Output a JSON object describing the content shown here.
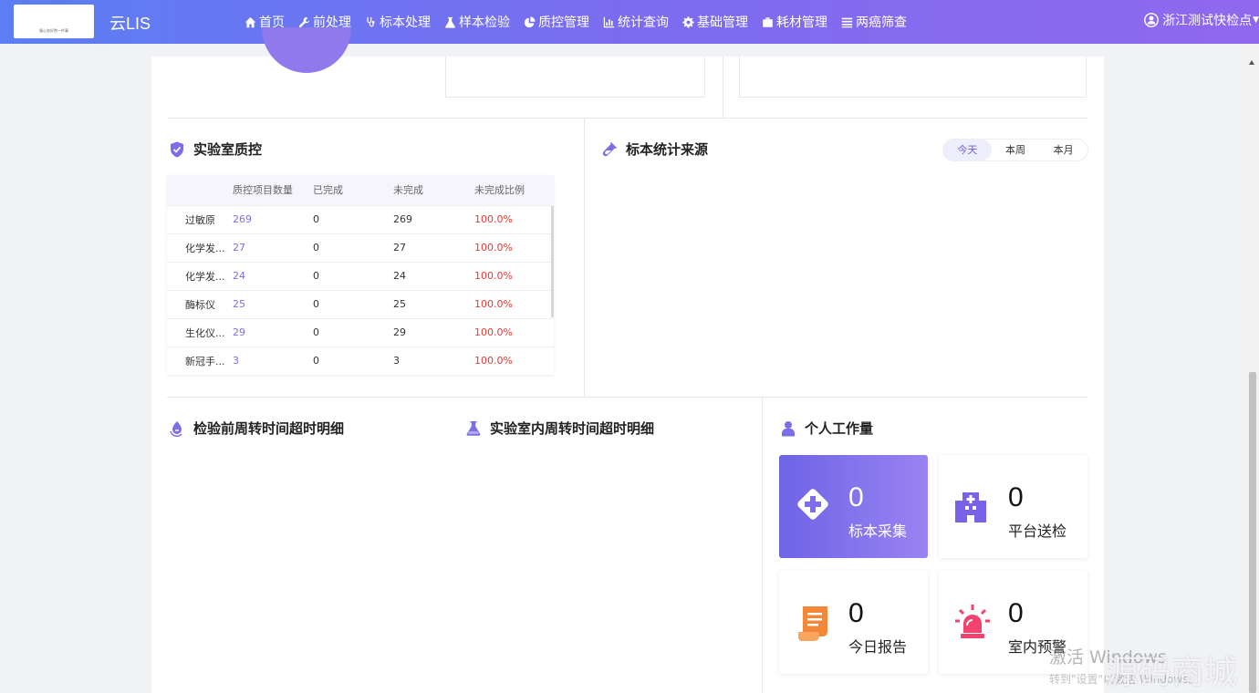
{
  "header": {
    "logo_text": "服心务好院一件事",
    "app_name": "云LIS",
    "nav": [
      {
        "label": "首页",
        "icon": "home-icon"
      },
      {
        "label": "前处理",
        "icon": "wrench-icon"
      },
      {
        "label": "标本处理",
        "icon": "stethoscope-icon"
      },
      {
        "label": "样本检验",
        "icon": "flask-icon"
      },
      {
        "label": "质控管理",
        "icon": "pie-icon"
      },
      {
        "label": "统计查询",
        "icon": "bar-chart-icon"
      },
      {
        "label": "基础管理",
        "icon": "gear-icon"
      },
      {
        "label": "耗材管理",
        "icon": "briefcase-icon"
      },
      {
        "label": "两癌筛查",
        "icon": "list-icon"
      }
    ],
    "user": "浙江测试快检点"
  },
  "qc": {
    "title": "实验室质控",
    "columns": [
      "",
      "质控项目数量",
      "已完成",
      "未完成",
      "未完成比例"
    ],
    "rows": [
      {
        "name": "过敏原",
        "count": "269",
        "done": "0",
        "undone": "269",
        "ratio": "100.0%"
      },
      {
        "name": "化学发...",
        "count": "27",
        "done": "0",
        "undone": "27",
        "ratio": "100.0%"
      },
      {
        "name": "化学发...",
        "count": "24",
        "done": "0",
        "undone": "24",
        "ratio": "100.0%"
      },
      {
        "name": "酶标仪",
        "count": "25",
        "done": "0",
        "undone": "25",
        "ratio": "100.0%"
      },
      {
        "name": "生化仪...",
        "count": "29",
        "done": "0",
        "undone": "29",
        "ratio": "100.0%"
      },
      {
        "name": "新冠手...",
        "count": "3",
        "done": "0",
        "undone": "3",
        "ratio": "100.0%"
      }
    ]
  },
  "source": {
    "title": "标本统计来源",
    "tabs": [
      "今天",
      "本周",
      "本月"
    ],
    "active_tab": "今天"
  },
  "pre_tat": {
    "title": "检验前周转时间超时明细"
  },
  "lab_tat": {
    "title": "实验室内周转时间超时明细"
  },
  "workload": {
    "title": "个人工作量",
    "cards": [
      {
        "value": "0",
        "label": "标本采集",
        "icon": "diamond-plus-icon"
      },
      {
        "value": "0",
        "label": "平台送检",
        "icon": "hospital-icon"
      },
      {
        "value": "0",
        "label": "今日报告",
        "icon": "scroll-icon"
      },
      {
        "value": "0",
        "label": "室内预警",
        "icon": "alarm-icon"
      }
    ]
  },
  "watermark": {
    "line1": "激活 Windows",
    "line2": "转到\"设置\"以激活 Windows。",
    "brand": "源码商城"
  },
  "colors": {
    "header_gradient_start": "#5b7ef2",
    "header_gradient_end": "#8f68ee",
    "accent": "#7c6ee8",
    "danger": "#e53935",
    "orange": "#f4883a",
    "alarm": "#f2436e"
  }
}
